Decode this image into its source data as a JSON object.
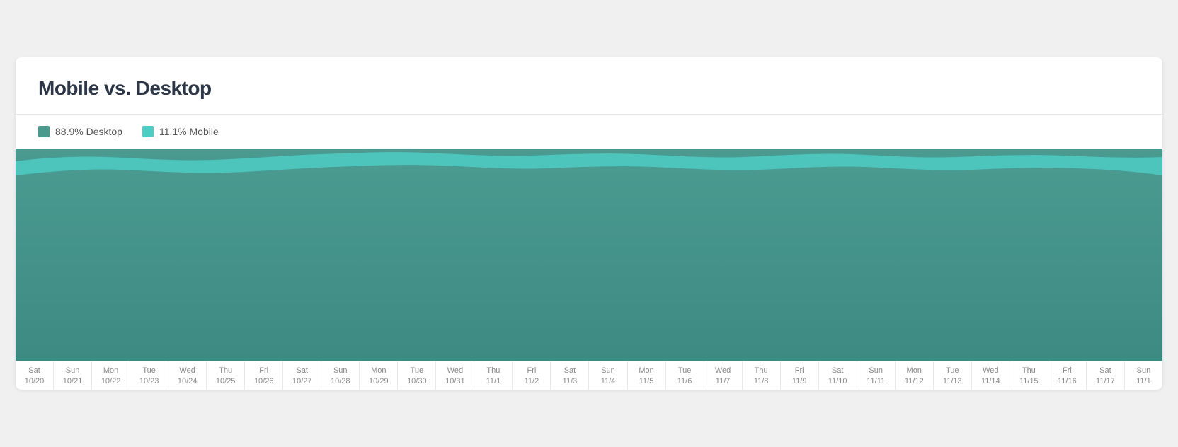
{
  "card": {
    "title": "Mobile vs. Desktop"
  },
  "legend": {
    "desktop_pct": "88.9% Desktop",
    "mobile_pct": "11.1% Mobile",
    "desktop_color": "#4a9a8e",
    "mobile_color": "#4ecdc4"
  },
  "xAxis": {
    "items": [
      {
        "day": "Sat",
        "date": "10/20"
      },
      {
        "day": "Sun",
        "date": "10/21"
      },
      {
        "day": "Mon",
        "date": "10/22"
      },
      {
        "day": "Tue",
        "date": "10/23"
      },
      {
        "day": "Wed",
        "date": "10/24"
      },
      {
        "day": "Thu",
        "date": "10/25"
      },
      {
        "day": "Fri",
        "date": "10/26"
      },
      {
        "day": "Sat",
        "date": "10/27"
      },
      {
        "day": "Sun",
        "date": "10/28"
      },
      {
        "day": "Mon",
        "date": "10/29"
      },
      {
        "day": "Tue",
        "date": "10/30"
      },
      {
        "day": "Wed",
        "date": "10/31"
      },
      {
        "day": "Thu",
        "date": "11/1"
      },
      {
        "day": "Fri",
        "date": "11/2"
      },
      {
        "day": "Sat",
        "date": "11/3"
      },
      {
        "day": "Sun",
        "date": "11/4"
      },
      {
        "day": "Mon",
        "date": "11/5"
      },
      {
        "day": "Tue",
        "date": "11/6"
      },
      {
        "day": "Wed",
        "date": "11/7"
      },
      {
        "day": "Thu",
        "date": "11/8"
      },
      {
        "day": "Fri",
        "date": "11/9"
      },
      {
        "day": "Sat",
        "date": "11/10"
      },
      {
        "day": "Sun",
        "date": "11/11"
      },
      {
        "day": "Mon",
        "date": "11/12"
      },
      {
        "day": "Tue",
        "date": "11/13"
      },
      {
        "day": "Wed",
        "date": "11/14"
      },
      {
        "day": "Thu",
        "date": "11/15"
      },
      {
        "day": "Fri",
        "date": "11/16"
      },
      {
        "day": "Sat",
        "date": "11/17"
      },
      {
        "day": "Sun",
        "date": "11/1"
      }
    ]
  }
}
